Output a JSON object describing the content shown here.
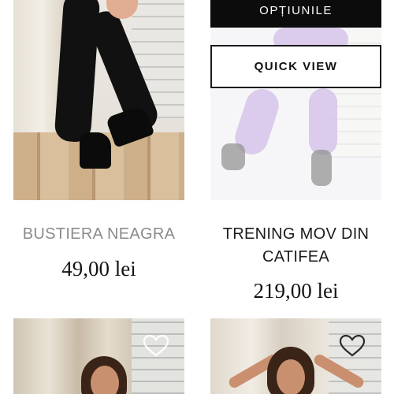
{
  "products": [
    {
      "title": "BUSTIERA NEAGRA",
      "price": "49,00 lei",
      "image_icon": "product-photo"
    },
    {
      "title_line1": "TRENING MOV DIN",
      "title_line2": "CATIFEA",
      "price": "219,00 lei",
      "options_label": "OPȚIUNILE",
      "quick_view_label": "QUICK VIEW",
      "image_icon": "product-photo"
    }
  ],
  "wishlist": {
    "icon": "heart-icon"
  },
  "colors": {
    "button_dark": "#0c0c0c",
    "title_muted": "#8b8b8b",
    "title_dark": "#1b1b1b",
    "accent_purple": "#d8c7ea"
  }
}
